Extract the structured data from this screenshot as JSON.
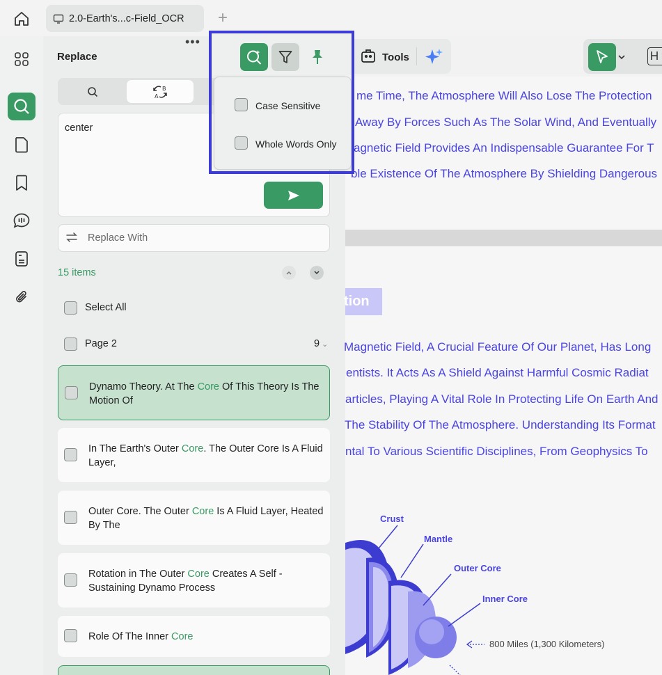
{
  "tab": {
    "title": "2.0-Earth's...c-Field_OCR"
  },
  "panel": {
    "title": "Replace",
    "more": "•••",
    "search_text": "center",
    "replace_placeholder": "Replace With",
    "items_count": "15 items",
    "select_all": "Select All",
    "page_group": {
      "label": "Page 2",
      "count": "9"
    },
    "results": [
      {
        "before": "Dynamo Theory. At The ",
        "match": "Core",
        "after": " Of This Theory Is The Motion Of",
        "selected": true
      },
      {
        "before": "In The Earth's Outer ",
        "match": "Core",
        "after": ". The Outer Core Is A Fluid Layer,",
        "selected": false
      },
      {
        "before": "Outer Core. The Outer ",
        "match": "Core",
        "after": " Is A Fluid Layer, Heated By The",
        "selected": false
      },
      {
        "before": "Rotation in The Outer ",
        "match": "Core",
        "after": " Creates A Self - Sustaining Dynamo Process",
        "selected": false
      },
      {
        "before": "Role Of The Inner ",
        "match": "Core",
        "after": "",
        "selected": false
      }
    ]
  },
  "popup": {
    "options": [
      {
        "label": "Case Sensitive",
        "checked": false
      },
      {
        "label": "Whole Words Only",
        "checked": false
      }
    ]
  },
  "toolbar": {
    "tools_label": "Tools"
  },
  "document": {
    "page1_lines": [
      "me Time, The Atmosphere Will Also Lose The Protection",
      "Away By Forces Such As The Solar Wind, And Eventually",
      "agnetic Field Provides An Indispensable Guarantee For T",
      "ble Existence Of The Atmosphere By Shielding Dangerous"
    ],
    "heading_fragment": "tion",
    "page2_lines": [
      "Magnetic Field, A Crucial Feature Of Our Planet, Has Long",
      "entists. It Acts As A Shield Against Harmful Cosmic Radiat",
      "articles, Playing A Vital Role In Protecting Life On Earth And",
      "The Stability Of The Atmosphere. Understanding Its Format",
      "ntal To Various Scientific Disciplines, From Geophysics To"
    ],
    "diagram_labels": {
      "crust": "Crust",
      "mantle": "Mantle",
      "outer_core": "Outer Core",
      "inner_core": "Inner Core",
      "distance": "800 Miles (1,300 Kilometers)"
    }
  },
  "colors": {
    "accent": "#3a9a64",
    "doc_text": "#4a44e0",
    "highlight_frame": "#3d3dd6"
  },
  "icons": [
    "home-icon",
    "monitor-icon",
    "plus-icon",
    "grid-icon",
    "search-icon",
    "page-icon",
    "bookmark-icon",
    "comment-icon",
    "document-icon",
    "paperclip-icon",
    "replace-icon",
    "send-icon",
    "swap-icon",
    "chevron-up-icon",
    "chevron-down-icon",
    "filter-icon",
    "pin-icon",
    "ai-sparkle-icon",
    "cursor-icon"
  ]
}
